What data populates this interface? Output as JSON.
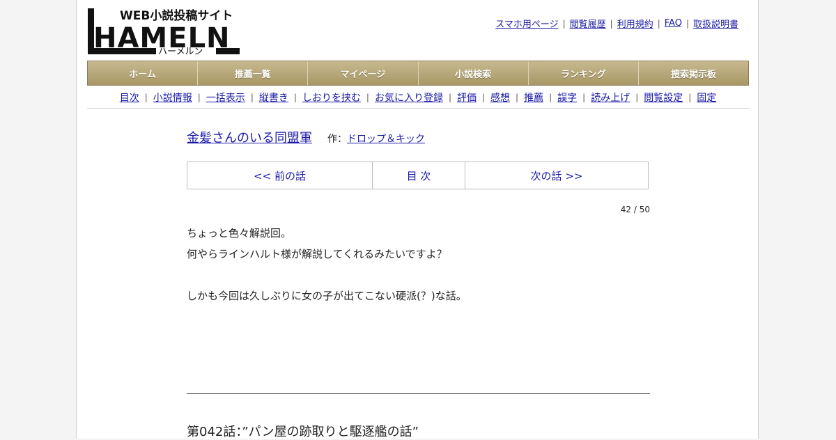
{
  "logo": {
    "tagline": "WEB小説投稿サイト",
    "wordmark": "HAMELN",
    "reading": "ハーメルン"
  },
  "header_links": [
    "スマホ用ページ",
    "閲覧履歴",
    "利用規約",
    "FAQ",
    "取扱説明書"
  ],
  "nav": [
    "ホーム",
    "推薦一覧",
    "マイページ",
    "小説検索",
    "ランキング",
    "捜索掲示板"
  ],
  "subnav": [
    "目次",
    "小説情報",
    "一括表示",
    "縦書き",
    "しおりを挟む",
    "お気に入り登録",
    "評価",
    "感想",
    "推薦",
    "誤字",
    "読み上げ",
    "閲覧設定",
    "固定"
  ],
  "novel": {
    "title": "金髪さんのいる同盟軍",
    "author_prefix": "作：",
    "author": "ドロップ＆キック"
  },
  "chapter_nav": {
    "prev": "<< 前の話",
    "toc": "目 次",
    "next": "次の話 >>"
  },
  "progress": "42 / 50",
  "preface": [
    "ちょっと色々解説回。",
    "何やらラインハルト様が解説してくれるみたいですよ？",
    "",
    "しかも今回は久しぶりに女の子が出てこない硬派(？)な話。"
  ],
  "chapter_title": "第042話：”パン屋の跡取りと駆逐艦の話”"
}
